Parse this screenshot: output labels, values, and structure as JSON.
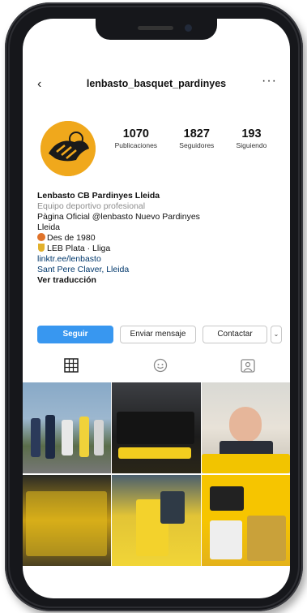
{
  "header": {
    "back_icon": "chevron-left-icon",
    "username": "lenbasto_basquet_pardinyes",
    "more_icon": "more-horizontal-icon"
  },
  "stats": {
    "posts": {
      "value": "1070",
      "label": "Publicaciones"
    },
    "followers": {
      "value": "1827",
      "label": "Seguidores"
    },
    "following": {
      "value": "193",
      "label": "Siguiendo"
    }
  },
  "bio": {
    "name": "Lenbasto CB Pardinyes Lleida",
    "category": "Equipo deportivo profesional",
    "line3": "Pàgina Oficial @lenbasto Nuevo Pardinyes",
    "line4": "Lleida",
    "line5": "Des de 1980",
    "line6": "LEB Plata · Lliga",
    "link": "linktr.ee/lenbasto",
    "location": "Sant Pere Claver, Lleida",
    "translation": "Ver traducción"
  },
  "actions": {
    "follow": "Seguir",
    "message": "Enviar mensaje",
    "contact": "Contactar",
    "dropdown": "⌄"
  },
  "tabs": [
    "grid-icon",
    "reels-icon",
    "tagged-icon"
  ],
  "colors": {
    "follow_button": "#3897f0",
    "avatar_bg": "#f0a81c",
    "link": "#00376b"
  }
}
